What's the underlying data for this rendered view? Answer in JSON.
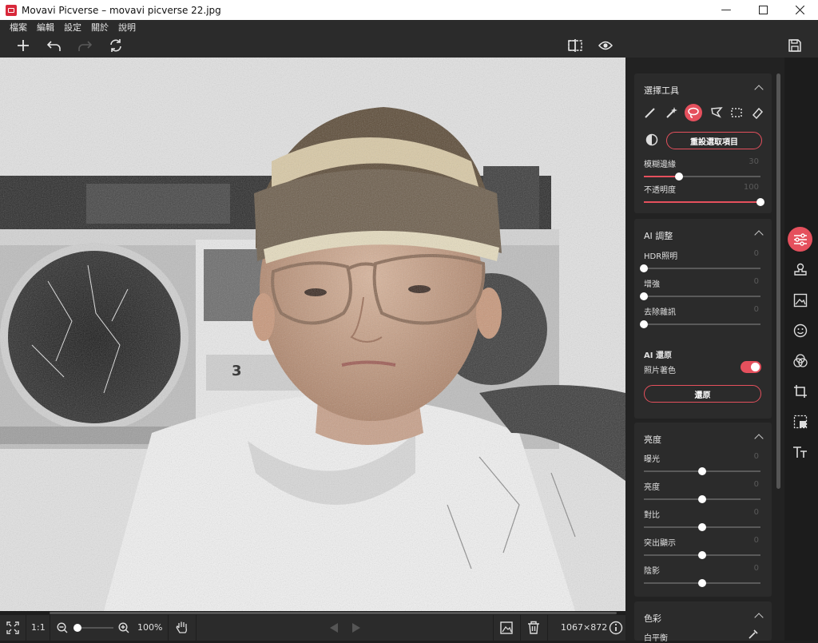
{
  "window": {
    "title": "Movavi Picverse – movavi picverse 22.jpg"
  },
  "menu": [
    "檔案",
    "編輯",
    "設定",
    "關於",
    "說明"
  ],
  "toolbar": {
    "icons": [
      "plus-icon",
      "undo-icon",
      "redo-icon",
      "reset-icon",
      "compare-split-icon",
      "preview-eye-icon",
      "save-icon"
    ]
  },
  "selection_tools": {
    "title": "選擇工具",
    "reset_label": "重設選取項目",
    "feather": {
      "label": "模糊邊緣",
      "value": "30",
      "level": 0.3
    },
    "opacity": {
      "label": "不透明度",
      "value": "100",
      "level": 1.0
    }
  },
  "ai_adjust": {
    "title": "AI 調整",
    "hdr": {
      "label": "HDR照明",
      "value": "0",
      "level": 0
    },
    "enhance": {
      "label": "增強",
      "value": "0",
      "level": 0
    },
    "denoise": {
      "label": "去除雜訊",
      "value": "0",
      "level": 0
    }
  },
  "ai_restore": {
    "title": "AI 還原",
    "colorize_label": "照片著色",
    "colorize_on": true,
    "restore_label": "還原"
  },
  "brightness": {
    "title": "亮度",
    "items": [
      {
        "label": "曝光",
        "value": "0",
        "level": 0.5
      },
      {
        "label": "亮度",
        "value": "0",
        "level": 0.5
      },
      {
        "label": "對比",
        "value": "0",
        "level": 0.5
      },
      {
        "label": "突出顯示",
        "value": "0",
        "level": 0.5
      },
      {
        "label": "陰影",
        "value": "0",
        "level": 0.5
      }
    ]
  },
  "color": {
    "title": "色彩",
    "white_balance_label": "白平衡"
  },
  "bottom": {
    "ratio_label": "1:1",
    "zoom_label": "100%",
    "zoom_level": 0.1,
    "dimensions": "1067×872"
  },
  "colors": {
    "accent": "#e5505d",
    "panel": "#2b2b2b",
    "background": "#1e1e1e"
  }
}
